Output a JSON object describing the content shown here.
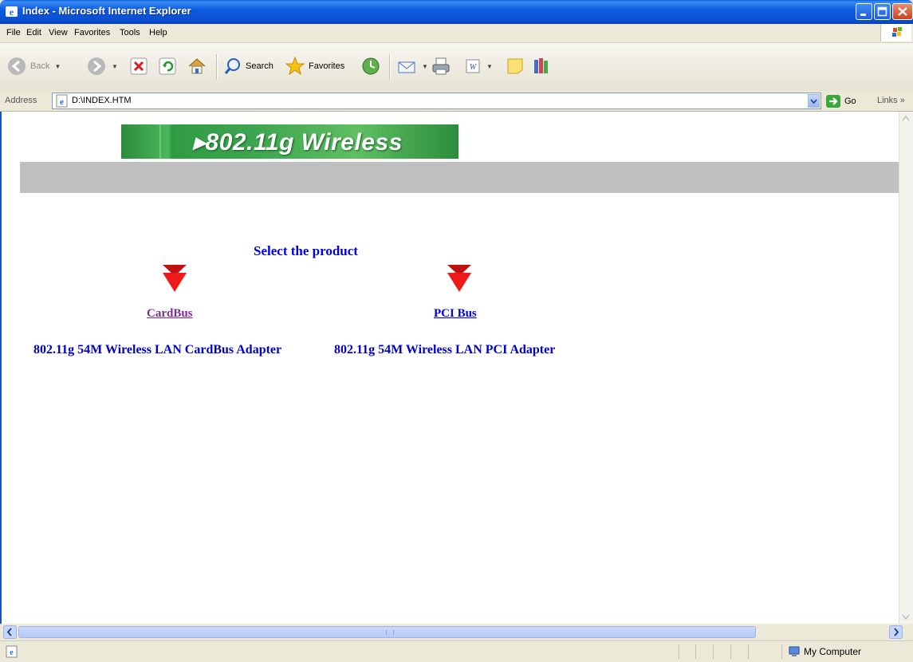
{
  "window": {
    "title": "Index - Microsoft Internet Explorer"
  },
  "menu": [
    "File",
    "Edit",
    "View",
    "Favorites",
    "Tools",
    "Help"
  ],
  "toolbar": {
    "back_label": "Back",
    "search_label": "Search",
    "favorites_label": "Favorites"
  },
  "address": {
    "label": "Address",
    "value": "D:\\INDEX.HTM",
    "go_label": "Go",
    "links_label": "Links"
  },
  "page": {
    "banner_text": "▸802.11g Wireless",
    "heading": "Select the product",
    "links": [
      {
        "label": "CardBus",
        "visited": true
      },
      {
        "label": "PCI Bus",
        "visited": false
      }
    ],
    "products": [
      "802.11g 54M Wireless LAN CardBus Adapter",
      "802.11g 54M Wireless LAN PCI Adapter"
    ]
  },
  "status": {
    "zone": "My Computer"
  },
  "colors": {
    "title_bar": "#0a4fd0",
    "link": "#0000e0",
    "visited_link": "#7a2c8c",
    "arrow": "#e01010",
    "banner": "#3ea650",
    "gray_bar": "#c0c0c0"
  }
}
